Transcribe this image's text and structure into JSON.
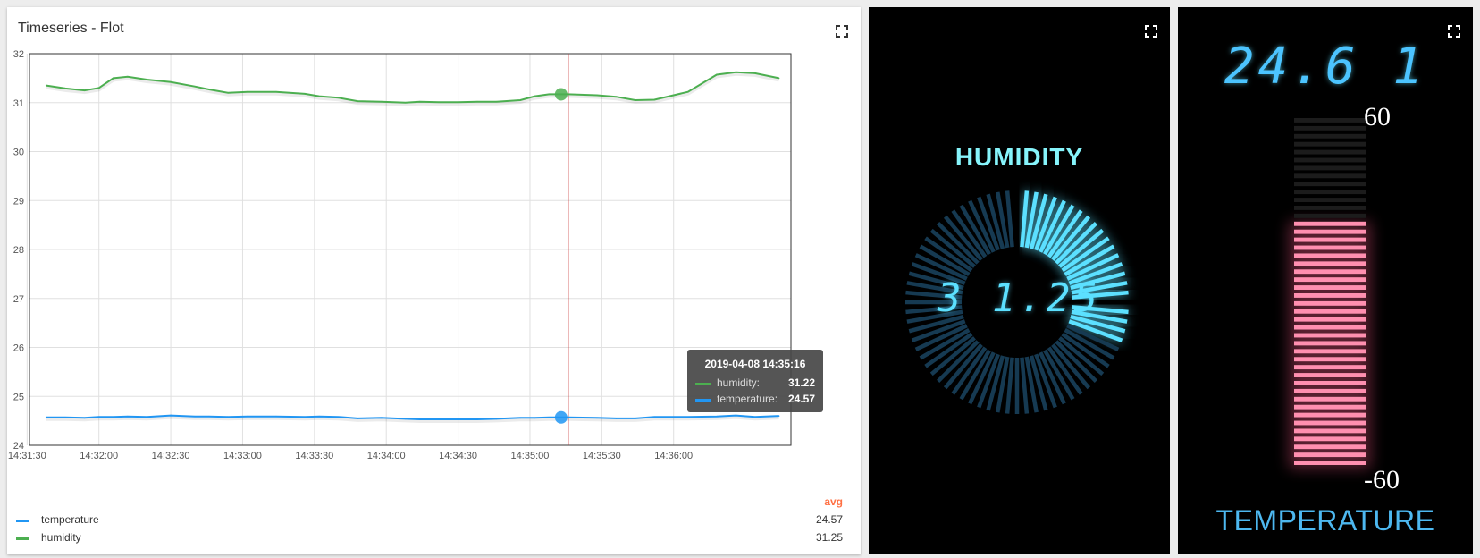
{
  "flot": {
    "title": "Timeseries - Flot",
    "legend_header": "avg",
    "legend": [
      {
        "label": "temperature",
        "value": "24.57",
        "color": "#2196f3"
      },
      {
        "label": "humidity",
        "value": "31.25",
        "color": "#4caf50"
      }
    ],
    "tooltip": {
      "title": "2019-04-08 14:35:16",
      "rows": [
        {
          "label": "humidity:",
          "value": "31.22",
          "color": "#4caf50"
        },
        {
          "label": "temperature:",
          "value": "24.57",
          "color": "#2196f3"
        }
      ]
    }
  },
  "chart_data": {
    "type": "line",
    "title": "Timeseries - Flot",
    "xlabel": "",
    "ylabel": "",
    "ylim": [
      24,
      32
    ],
    "y_ticks": [
      "24",
      "25",
      "26",
      "27",
      "28",
      "29",
      "30",
      "31",
      "32"
    ],
    "x_ticks": [
      "14:31:30",
      "14:32:00",
      "14:32:30",
      "14:33:00",
      "14:33:30",
      "14:34:00",
      "14:34:30",
      "14:35:00",
      "14:35:30",
      "14:36:00"
    ],
    "xlim": [
      "14:31:31",
      "14:36:49"
    ],
    "grid": true,
    "crosshair_x": "14:35:16",
    "series": [
      {
        "name": "humidity",
        "color": "#4caf50",
        "x": [
          "14:31:38",
          "14:31:46",
          "14:31:54",
          "14:32:00",
          "14:32:06",
          "14:32:12",
          "14:32:20",
          "14:32:30",
          "14:32:40",
          "14:32:46",
          "14:32:54",
          "14:33:02",
          "14:33:14",
          "14:33:26",
          "14:33:32",
          "14:33:40",
          "14:33:48",
          "14:33:58",
          "14:34:08",
          "14:34:14",
          "14:34:22",
          "14:34:30",
          "14:34:38",
          "14:34:46",
          "14:34:56",
          "14:35:02",
          "14:35:08",
          "14:35:16",
          "14:35:28",
          "14:35:36",
          "14:35:44",
          "14:35:52",
          "14:36:06",
          "14:36:18",
          "14:36:26",
          "14:36:34",
          "14:36:44"
        ],
        "values": [
          31.35,
          31.29,
          31.25,
          31.3,
          31.5,
          31.53,
          31.47,
          31.42,
          31.33,
          31.27,
          31.2,
          31.22,
          31.22,
          31.18,
          31.13,
          31.1,
          31.03,
          31.02,
          31.0,
          31.02,
          31.01,
          31.01,
          31.02,
          31.02,
          31.05,
          31.13,
          31.17,
          31.17,
          31.15,
          31.12,
          31.05,
          31.06,
          31.22,
          31.57,
          31.62,
          31.6,
          31.5
        ]
      },
      {
        "name": "temperature",
        "color": "#2196f3",
        "x": [
          "14:31:38",
          "14:31:46",
          "14:31:54",
          "14:32:00",
          "14:32:06",
          "14:32:12",
          "14:32:20",
          "14:32:30",
          "14:32:40",
          "14:32:46",
          "14:32:54",
          "14:33:02",
          "14:33:14",
          "14:33:26",
          "14:33:32",
          "14:33:40",
          "14:33:48",
          "14:33:58",
          "14:34:08",
          "14:34:14",
          "14:34:22",
          "14:34:30",
          "14:34:38",
          "14:34:46",
          "14:34:56",
          "14:35:02",
          "14:35:08",
          "14:35:16",
          "14:35:28",
          "14:35:36",
          "14:35:44",
          "14:35:52",
          "14:36:06",
          "14:36:18",
          "14:36:26",
          "14:36:34",
          "14:36:44"
        ],
        "values": [
          24.57,
          24.57,
          24.56,
          24.58,
          24.58,
          24.59,
          24.58,
          24.61,
          24.59,
          24.59,
          24.58,
          24.59,
          24.59,
          24.58,
          24.59,
          24.58,
          24.55,
          24.56,
          24.54,
          24.53,
          24.53,
          24.53,
          24.53,
          24.54,
          24.56,
          24.56,
          24.57,
          24.57,
          24.56,
          24.55,
          24.55,
          24.58,
          24.58,
          24.59,
          24.61,
          24.58,
          24.6
        ]
      }
    ]
  },
  "humidity": {
    "title": "HUMIDITY",
    "value": "31.25",
    "display_value": "3 1.25",
    "min": 0,
    "max": 100,
    "color": "#5ce0ff"
  },
  "temperature": {
    "title": "TEMPERATURE",
    "value": "24.61",
    "display_value": "24.6 1",
    "min_label": "-60",
    "max_label": "60",
    "min": -60,
    "max": 60,
    "color": "#4cc4ff",
    "bar_color": "#ff8fb0"
  }
}
